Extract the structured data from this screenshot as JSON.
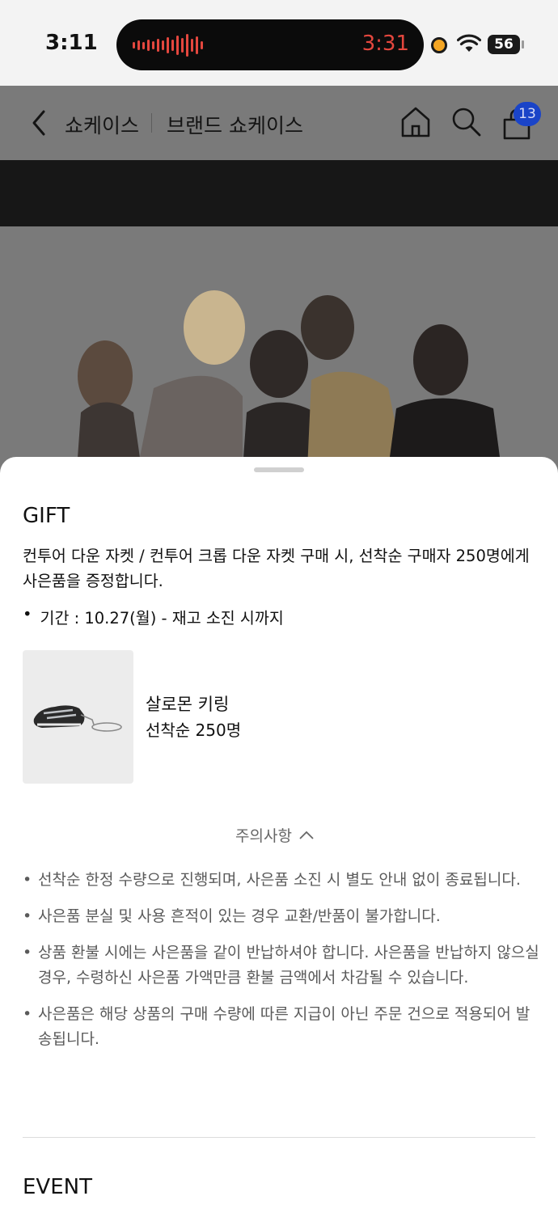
{
  "status_bar": {
    "time": "3:11",
    "call_timer": "3:31",
    "battery": "56",
    "accent": "#e4473e"
  },
  "header": {
    "title": "쇼케이스",
    "subtitle": "브랜드 쇼케이스",
    "cart_count": "13",
    "icons": [
      "back-icon",
      "home-icon",
      "search-icon",
      "bag-icon"
    ],
    "badge_color": "#1a44c8"
  },
  "gift": {
    "title": "GIFT",
    "description": "컨투어 다운 자켓 / 컨투어 크롭 다운 자켓 구매 시, 선착순 구매자 250명에게 사은품을 증정합니다.",
    "period_bullet": "•",
    "period": "기간 : 10.27(월) - 재고 소진 시까지",
    "item": {
      "name": "살로몬 키링",
      "quantity": "선착순 250명"
    },
    "notice_toggle": "주의사항",
    "notices": [
      "선착순 한정 수량으로 진행되며, 사은품 소진 시 별도 안내 없이 종료됩니다.",
      "사은품 분실 및 사용 흔적이 있는 경우 교환/반품이 불가합니다.",
      "상품 환불 시에는 사은품을 같이 반납하셔야 합니다. 사은품을 반납하지 않으실 경우, 수령하신 사은품 가액만큼 환불 금액에서 차감될 수 있습니다.",
      "사은품은 해당 상품의 구매 수량에 따른 지급이 아닌 주문 건으로 적용되어 발송됩니다."
    ]
  },
  "event": {
    "title": "EVENT"
  }
}
